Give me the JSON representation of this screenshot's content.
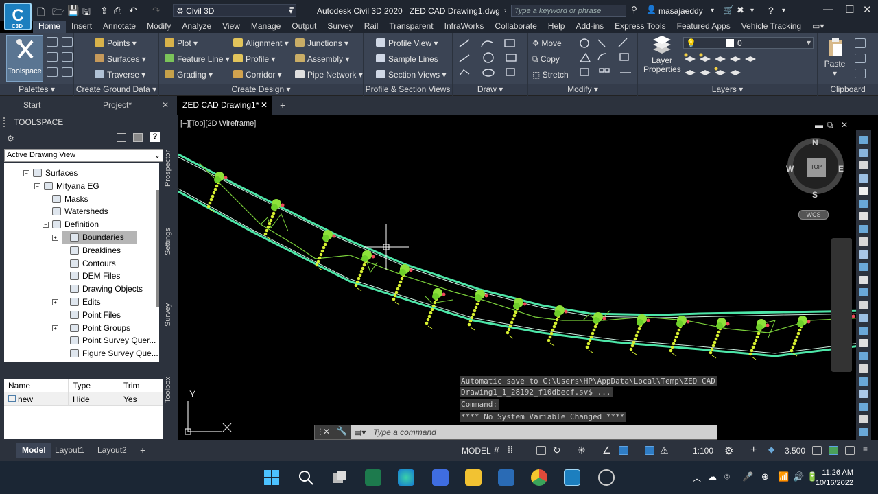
{
  "titlebar": {
    "app_title": "Autodesk Civil 3D 2020",
    "document_title": "ZED CAD Drawing1.dwg",
    "workspace": "Civil 3D",
    "search_placeholder": "Type a keyword or phrase",
    "username": "masajaeddy",
    "app_button_label": "C3D"
  },
  "menu": {
    "tabs": [
      "Home",
      "Insert",
      "Annotate",
      "Modify",
      "Analyze",
      "View",
      "Manage",
      "Output",
      "Survey",
      "Rail",
      "Transparent",
      "InfraWorks",
      "Collaborate",
      "Help",
      "Add-ins",
      "Express Tools",
      "Featured Apps",
      "Vehicle Tracking"
    ],
    "active": "Home"
  },
  "ribbon": {
    "palettes": {
      "title": "Palettes",
      "toolspace_label": "Toolspace"
    },
    "ground": {
      "title": "Create Ground Data",
      "items": [
        "Points",
        "Surfaces",
        "Traverse"
      ]
    },
    "design": {
      "title": "Create Design",
      "col1": [
        "Plot",
        "Feature Line",
        "Grading"
      ],
      "col2": [
        "Alignment",
        "Profile",
        "Corridor"
      ],
      "col3": [
        "Junctions",
        "Assembly",
        "Pipe Network"
      ]
    },
    "profile": {
      "title": "Profile & Section Views",
      "items": [
        "Profile View",
        "Sample Lines",
        "Section Views"
      ]
    },
    "draw": {
      "title": "Draw"
    },
    "modify": {
      "title": "Modify",
      "items": [
        "Move",
        "Copy",
        "Stretch"
      ]
    },
    "layers": {
      "title": "Layers",
      "properties_label": "Layer Properties",
      "current_layer": "0"
    },
    "clipboard": {
      "title": "Clipboard",
      "paste_label": "Paste"
    }
  },
  "doctabs": {
    "tabs": [
      "Start",
      "Project*",
      "ZED CAD Drawing1*"
    ],
    "active": "ZED CAD Drawing1*"
  },
  "toolspace": {
    "header": "TOOLSPACE",
    "view_select": "Active Drawing View",
    "side_tabs": [
      "Prospector",
      "Settings",
      "Survey",
      "Toolbox"
    ],
    "tree": [
      {
        "label": "Surfaces",
        "level": 0
      },
      {
        "label": "Mityana EG",
        "level": 1
      },
      {
        "label": "Masks",
        "level": 2
      },
      {
        "label": "Watersheds",
        "level": 2
      },
      {
        "label": "Definition",
        "level": 2
      },
      {
        "label": "Boundaries",
        "level": 3,
        "selected": true
      },
      {
        "label": "Breaklines",
        "level": 3
      },
      {
        "label": "Contours",
        "level": 3
      },
      {
        "label": "DEM Files",
        "level": 3
      },
      {
        "label": "Drawing Objects",
        "level": 3
      },
      {
        "label": "Edits",
        "level": 3
      },
      {
        "label": "Point Files",
        "level": 3
      },
      {
        "label": "Point Groups",
        "level": 3
      },
      {
        "label": "Point Survey Quer...",
        "level": 3
      },
      {
        "label": "Figure Survey Que...",
        "level": 3
      }
    ],
    "table": {
      "columns": [
        "Name",
        "Type",
        "Trim"
      ],
      "rows": [
        [
          "new",
          "Hide",
          "Yes"
        ]
      ]
    }
  },
  "viewport": {
    "label": "[−][Top][2D Wireframe]",
    "compass": {
      "n": "N",
      "s": "S",
      "e": "E",
      "w": "W",
      "top": "TOP"
    },
    "wcs": "WCS",
    "ucs_y": "Y"
  },
  "console": {
    "lines": [
      "Automatic save to C:\\Users\\HP\\AppData\\Local\\Temp\\ZED CAD",
      "Drawing1_1_28192_f10dbecf.sv$ ...",
      "Command:",
      "**** No System Variable Changed ****"
    ],
    "input_placeholder": "Type a command"
  },
  "status": {
    "layout_tabs": [
      "Model",
      "Layout1",
      "Layout2"
    ],
    "active_tab": "Model",
    "model_label": "MODEL",
    "scale": "1:100",
    "value": "3.500"
  },
  "taskbar": {
    "time": "11:26 AM",
    "date": "10/16/2022"
  },
  "colors": {
    "accent": "#2f7dc5",
    "road_edge": "#4de6a8",
    "vegetation": "#8ee23a",
    "points": "#d7f030"
  }
}
